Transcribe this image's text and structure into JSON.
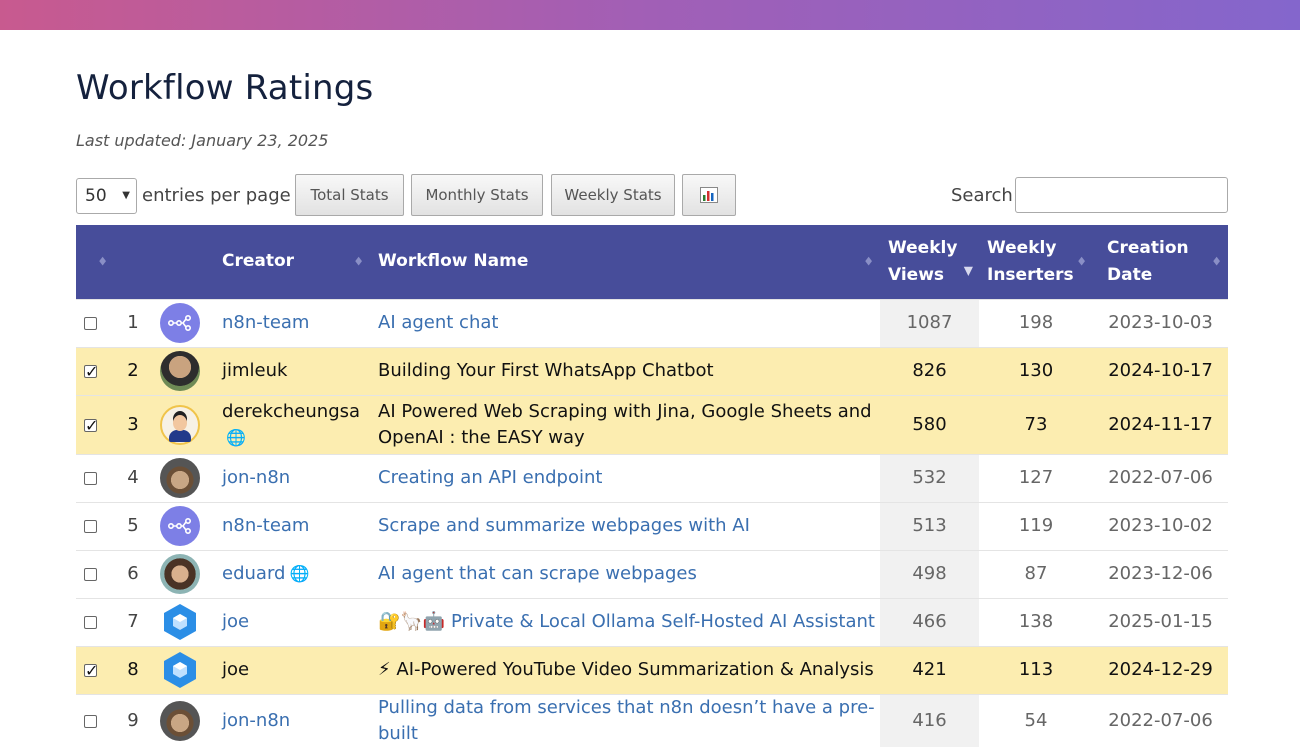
{
  "page": {
    "title": "Workflow Ratings",
    "last_updated": "Last updated: January 23, 2025"
  },
  "controls": {
    "entries_value": "50",
    "entries_label": "entries per page",
    "buttons": {
      "total": "Total Stats",
      "monthly": "Monthly Stats",
      "weekly": "Weekly Stats",
      "chart_icon": "bar-chart-icon"
    },
    "search_label": "Search:",
    "search_value": ""
  },
  "table": {
    "headers": {
      "creator": "Creator",
      "workflow_name": "Workflow Name",
      "weekly_views": "Weekly Views",
      "weekly_inserters": "Weekly Inserters",
      "creation_date": "Creation Date"
    },
    "sorted_column": "weekly_views",
    "rows": [
      {
        "index": "1",
        "checked": false,
        "creator": "n8n-team",
        "avatar": "n8n-logo",
        "verified": false,
        "workflow": "AI agent chat",
        "views": "1087",
        "inserters": "198",
        "date": "2023-10-03"
      },
      {
        "index": "2",
        "checked": true,
        "creator": "jimleuk",
        "avatar": "photo",
        "verified": false,
        "workflow": "Building Your First WhatsApp Chatbot",
        "views": "826",
        "inserters": "130",
        "date": "2024-10-17"
      },
      {
        "index": "3",
        "checked": true,
        "creator": "derekcheungsa",
        "avatar": "cartoon",
        "verified": true,
        "workflow": "AI Powered Web Scraping with Jina, Google Sheets and OpenAI : the EASY way",
        "views": "580",
        "inserters": "73",
        "date": "2024-11-17"
      },
      {
        "index": "4",
        "checked": false,
        "creator": "jon-n8n",
        "avatar": "illustration",
        "verified": false,
        "workflow": "Creating an API endpoint",
        "views": "532",
        "inserters": "127",
        "date": "2022-07-06"
      },
      {
        "index": "5",
        "checked": false,
        "creator": "n8n-team",
        "avatar": "n8n-logo",
        "verified": false,
        "workflow": "Scrape and summarize webpages with AI",
        "views": "513",
        "inserters": "119",
        "date": "2023-10-02"
      },
      {
        "index": "6",
        "checked": false,
        "creator": "eduard",
        "avatar": "photo",
        "verified": true,
        "workflow": "AI agent that can scrape webpages",
        "views": "498",
        "inserters": "87",
        "date": "2023-12-06"
      },
      {
        "index": "7",
        "checked": false,
        "creator": "joe",
        "avatar": "hex-logo",
        "verified": false,
        "workflow_prefix": "🔐🦙🤖",
        "workflow": "Private & Local Ollama Self-Hosted AI Assistant",
        "views": "466",
        "inserters": "138",
        "date": "2025-01-15"
      },
      {
        "index": "8",
        "checked": true,
        "creator": "joe",
        "avatar": "hex-logo",
        "verified": false,
        "workflow_prefix": "⚡",
        "workflow": "AI-Powered YouTube Video Summarization & Analysis",
        "views": "421",
        "inserters": "113",
        "date": "2024-12-29"
      },
      {
        "index": "9",
        "checked": false,
        "creator": "jon-n8n",
        "avatar": "illustration",
        "verified": false,
        "workflow": "Pulling data from services that n8n doesn’t have a pre-built",
        "views": "416",
        "inserters": "54",
        "date": "2022-07-06"
      }
    ]
  },
  "colors": {
    "header_bg": "#474d9a",
    "selected_row_bg": "#fcedb0",
    "link": "#3a6fb0",
    "n8n_avatar": "#7d7fe6"
  }
}
